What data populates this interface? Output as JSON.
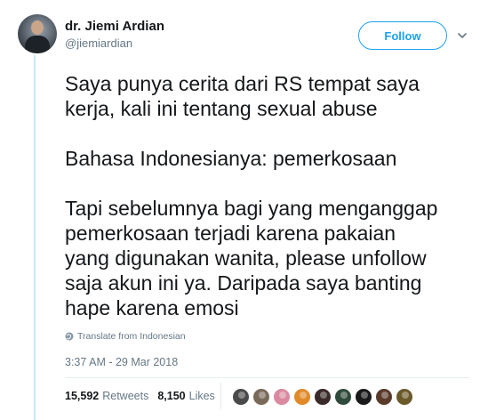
{
  "author": {
    "display_name": "dr. Jiemi Ardian",
    "handle": "@jiemiardian"
  },
  "follow_button": {
    "label": "Follow"
  },
  "tweet": {
    "paragraphs": [
      [
        "Saya punya cerita dari RS tempat saya",
        "kerja, kali ini tentang sexual abuse"
      ],
      [
        "Bahasa Indonesianya: pemerkosaan"
      ],
      [
        "Tapi sebelumnya bagi yang menganggap",
        "pemerkosaan terjadi karena pakaian",
        "yang digunakan wanita, please unfollow",
        "saja akun ini ya. Daripada saya banting",
        "hape karena emosi"
      ]
    ],
    "translate_label": "Translate from Indonesian",
    "timestamp": "3:37 AM - 29 Mar 2018"
  },
  "stats": {
    "retweets_count": "15,592",
    "retweets_label": "Retweets",
    "likes_count": "8,150",
    "likes_label": "Likes"
  },
  "liker_avatars": [
    {
      "color": "#4a4a4a"
    },
    {
      "color": "#7a6a5a"
    },
    {
      "color": "#d98aa0"
    },
    {
      "color": "#e08a2a"
    },
    {
      "color": "#3a2a2a"
    },
    {
      "color": "#2f4a3a"
    },
    {
      "color": "#1a1a1a"
    },
    {
      "color": "#5a3a2a"
    },
    {
      "color": "#6a5a2a"
    }
  ],
  "colors": {
    "accent": "#1da1f2",
    "muted_text": "#657786",
    "thread_line": "#c4e9fc"
  }
}
